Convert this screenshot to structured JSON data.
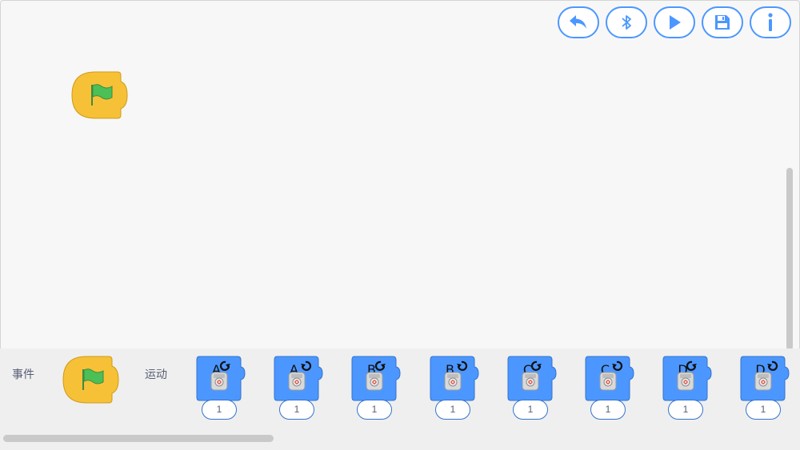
{
  "toolbar": {
    "buttons": [
      {
        "name": "undo",
        "icon": "undo-arrow-icon"
      },
      {
        "name": "bluetooth",
        "icon": "bluetooth-icon"
      },
      {
        "name": "run",
        "icon": "play-icon"
      },
      {
        "name": "save",
        "icon": "save-icon"
      },
      {
        "name": "info",
        "icon": "info-icon"
      }
    ]
  },
  "colors": {
    "accent": "#4c97ff",
    "event_block": "#ffbf00",
    "motion_block": "#4c97ff",
    "flag": "#4cbf56"
  },
  "palette": {
    "events_label": "事件",
    "motion_label": "运动",
    "motor_blocks": [
      {
        "port": "A",
        "direction": "clockwise",
        "value": "1"
      },
      {
        "port": "A",
        "direction": "counterclockwise",
        "value": "1"
      },
      {
        "port": "B",
        "direction": "clockwise",
        "value": "1"
      },
      {
        "port": "B",
        "direction": "counterclockwise",
        "value": "1"
      },
      {
        "port": "C",
        "direction": "clockwise",
        "value": "1"
      },
      {
        "port": "C",
        "direction": "counterclockwise",
        "value": "1"
      },
      {
        "port": "D",
        "direction": "clockwise",
        "value": "1"
      },
      {
        "port": "D",
        "direction": "counterclockwise",
        "value": "1"
      }
    ]
  }
}
